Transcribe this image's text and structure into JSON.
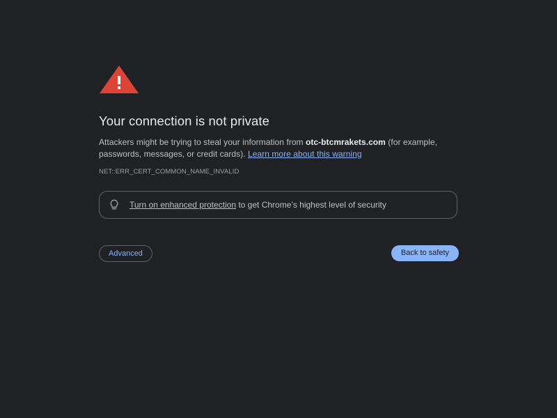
{
  "interstitial": {
    "icon": "warning-triangle-icon",
    "accent_color": "#db4437",
    "title": "Your connection is not private",
    "message_before": "Attackers might be trying to steal your information from ",
    "domain": "otc-btcmrakets.com",
    "message_after": " (for example, passwords, messages, or credit cards). ",
    "learn_more_link": "Learn more about this warning",
    "error_code": "NET::ERR_CERT_COMMON_NAME_INVALID"
  },
  "protection": {
    "icon": "lightbulb-icon",
    "link_text": "Turn on enhanced protection",
    "text": " to get Chrome’s highest level of security"
  },
  "buttons": {
    "advanced_label": "Advanced",
    "back_label": "Back to safety"
  }
}
